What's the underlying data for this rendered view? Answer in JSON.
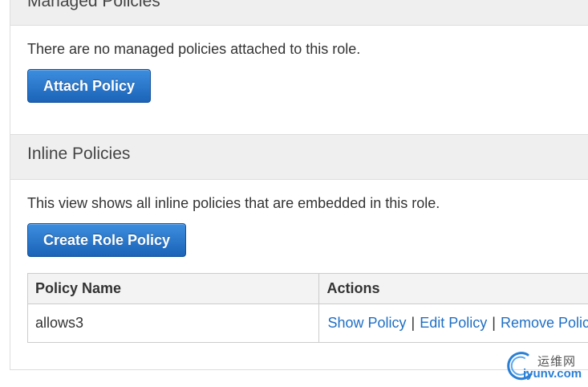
{
  "managed": {
    "title": "Managed Policies",
    "description": "There are no managed policies attached to this role.",
    "attach_label": "Attach Policy"
  },
  "inline": {
    "title": "Inline Policies",
    "description": "This view shows all inline policies that are embedded in this role.",
    "create_label": "Create Role Policy",
    "table": {
      "headers": [
        "Policy Name",
        "Actions"
      ],
      "rows": [
        {
          "name": "allows3",
          "actions": [
            "Show Policy",
            "Edit Policy",
            "Remove Policy"
          ],
          "separator": "|"
        }
      ]
    }
  },
  "watermark": {
    "cn_text": "运维网",
    "en_text": "iyunv.com"
  },
  "colors": {
    "button": "#1b63b8",
    "link": "#1f6fc5",
    "header_bg": "#efefef"
  }
}
